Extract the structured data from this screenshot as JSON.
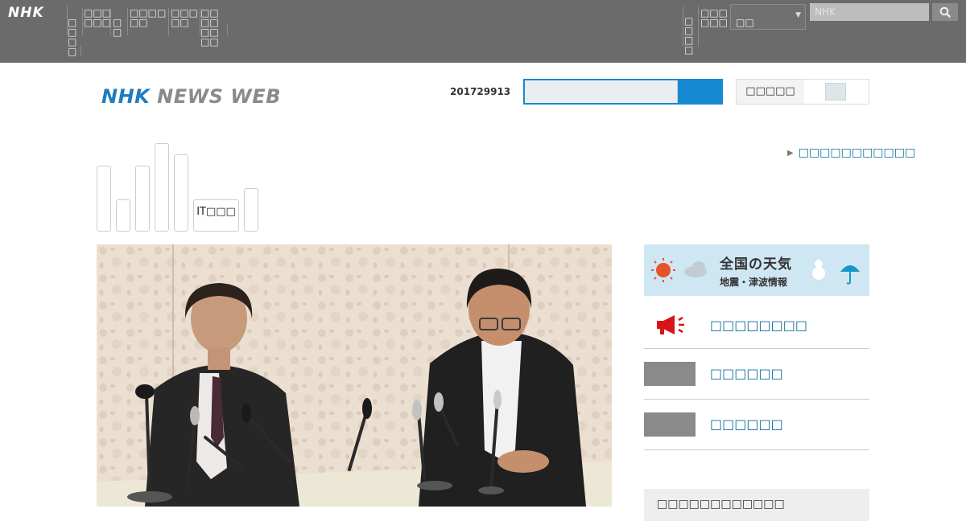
{
  "top_bar": {
    "logo": "NHK",
    "nav_items": [
      "□□□□",
      "□□□□□□",
      "□□",
      "□□□□□□",
      "□□□□□",
      "□□□□□□□□"
    ],
    "right_items": [
      "□□□□",
      "□□□□□□"
    ],
    "region_value": "□□",
    "search_placeholder": "NHK"
  },
  "header": {
    "logo_nhk": "NHK",
    "logo_news_web": "NEWS WEB",
    "date": "201729913",
    "font_size_label": "□□□□□"
  },
  "tabs": {
    "it_label": "IT□□□",
    "regional_link": "□□□□□□□□□□□"
  },
  "sidebar": {
    "weather_title": "全国の天気",
    "weather_sub": "地震・津波情報",
    "links": [
      "□□□□□□□□",
      "□□□□□□",
      "□□□□□□"
    ],
    "ranking_title": "□□□□□□□□□□□□"
  },
  "colors": {
    "topbar": "#6b6b6b",
    "accent_blue": "#1589d1",
    "link_blue": "#0d6c9a",
    "megaphone_red": "#d8141a"
  },
  "icons": [
    "search-icon",
    "megaphone-icon",
    "sun-icon",
    "cloud-icon",
    "snowman-icon",
    "umbrella-icon",
    "caret-down-icon",
    "triangle-right-icon"
  ]
}
